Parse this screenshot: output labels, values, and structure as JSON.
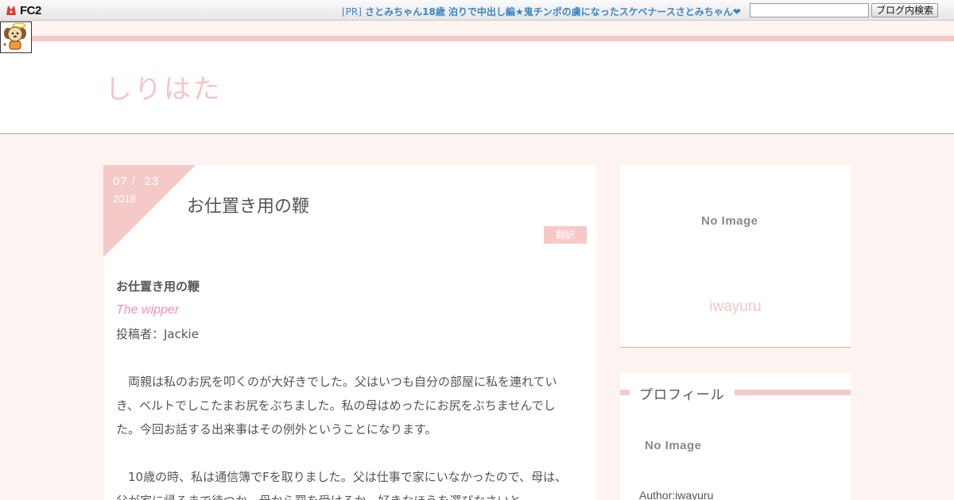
{
  "fc2_bar": {
    "logo_text": "FC2",
    "pr_tag": "[PR]",
    "pr_text": "さとみちゃん18歳 泊りで中出し編★鬼チンポの虜になったスケベナースさとみちゃん❤",
    "search_value": "",
    "search_button_label": "ブログ内検索"
  },
  "blog": {
    "title": "しりはた"
  },
  "entry": {
    "date_month_day": "07 /  23",
    "date_year": "2018",
    "title": "お仕置き用の鞭",
    "tag_label": "翻訳",
    "body_title": "お仕置き用の鞭",
    "body_english_title": "The wipper",
    "body_author": "投稿者：Jackie",
    "paragraph_1": "両親は私のお尻を叩くのが大好きでした。父はいつも自分の部屋に私を連れていき、ベルトでしこたまお尻をぶちました。私の母はめったにお尻をぶちませんでした。今回お話する出来事はその例外ということになります。",
    "paragraph_2": "10歳の時、私は通信簿でFを取りました。父は仕事で家にいなかったので、母は、父が家に帰るまで待つか、母から罰を受けるか、好きなほうを選びなさいと"
  },
  "sidebar": {
    "top_card": {
      "no_image_label": "No Image",
      "user_name": "iwayuru"
    },
    "profile": {
      "heading": "プロフィール",
      "no_image_label": "No Image",
      "author_line": "Author:iwayuru"
    }
  },
  "colors": {
    "accent_pink": "#f6c9c9",
    "title_pink": "#f6c5c5",
    "link_blue": "#3a86c8",
    "italic_pink": "#f08fbf",
    "page_bg": "#fdf3f1"
  }
}
